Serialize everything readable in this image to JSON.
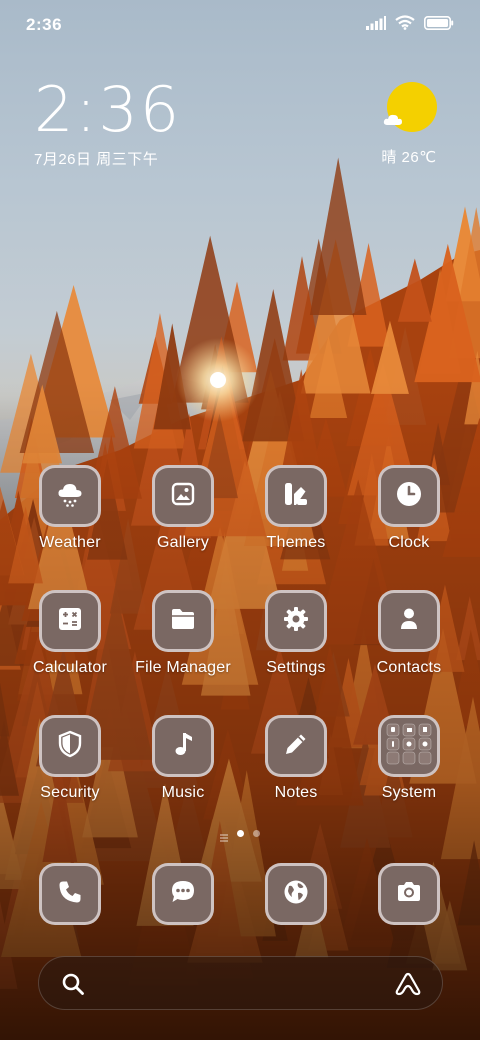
{
  "status_bar": {
    "time": "2:36"
  },
  "clock_widget": {
    "time": "2:36",
    "date": "7月26日 周三下午"
  },
  "weather_widget": {
    "text": "晴 26℃"
  },
  "apps": [
    {
      "label": "Weather",
      "icon": "cloud-snow-icon"
    },
    {
      "label": "Gallery",
      "icon": "image-icon"
    },
    {
      "label": "Themes",
      "icon": "themes-icon"
    },
    {
      "label": "Clock",
      "icon": "clock-icon"
    },
    {
      "label": "Calculator",
      "icon": "calculator-icon"
    },
    {
      "label": "File Manager",
      "icon": "folder-icon"
    },
    {
      "label": "Settings",
      "icon": "gear-icon"
    },
    {
      "label": "Contacts",
      "icon": "person-icon"
    },
    {
      "label": "Security",
      "icon": "shield-icon"
    },
    {
      "label": "Music",
      "icon": "music-note-icon"
    },
    {
      "label": "Notes",
      "icon": "pencil-icon"
    },
    {
      "label": "System",
      "icon": "folder-grid-icon"
    }
  ],
  "dock": [
    {
      "icon": "phone-icon"
    },
    {
      "icon": "chat-icon"
    },
    {
      "icon": "globe-icon"
    },
    {
      "icon": "camera-icon"
    }
  ],
  "pager": {
    "pages": 2,
    "current": 1
  },
  "colors": {
    "tile": "#7a6863",
    "tile_border": "#ebe1e1",
    "sun": "#f4d000",
    "forest": "#c8541a"
  }
}
